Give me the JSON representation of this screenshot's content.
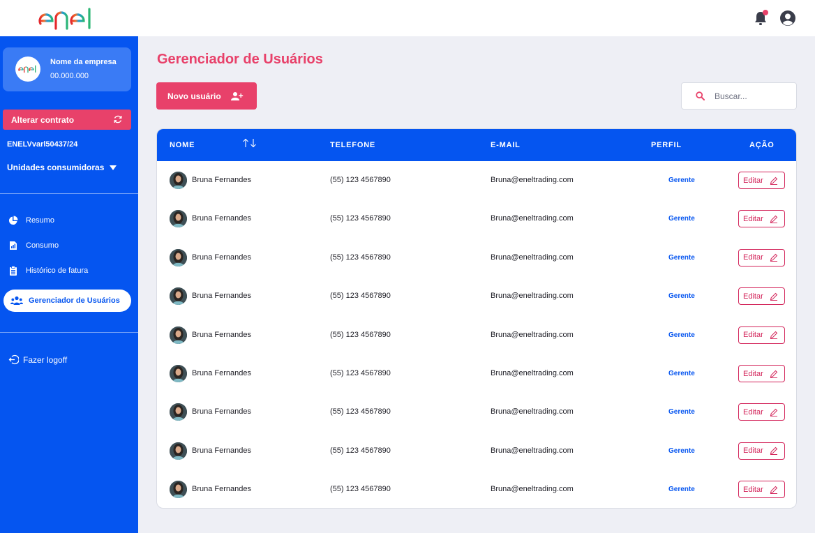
{
  "header": {
    "logo_text": "enel",
    "notification_icon": "bell-icon",
    "account_icon": "user-circle-icon"
  },
  "sidebar": {
    "company": {
      "name": "Nome da empresa",
      "code": "00.000.000",
      "avatar_text": "enel"
    },
    "change_contract_label": "Alterar contrato",
    "contract_code": "ENELVvarl50437/24",
    "units_label": "Unidades consumidoras",
    "nav": [
      {
        "label": "Resumo",
        "icon": "pie-chart-icon"
      },
      {
        "label": "Consumo",
        "icon": "bar-document-icon"
      },
      {
        "label": "Histórico de fatura",
        "icon": "clipboard-list-icon"
      },
      {
        "label": "Gerenciador de Usuários",
        "icon": "users-icon",
        "active": true
      }
    ],
    "logoff_label": "Fazer logoff"
  },
  "main": {
    "title": "Gerenciador de Usuários",
    "new_user_label": "Novo usuário",
    "search_placeholder": "Buscar...",
    "table": {
      "columns": [
        "NOME",
        "TELEFONE",
        "E-MAIL",
        "PERFIL",
        "AÇÃO"
      ],
      "sort_glyph": "↑↓",
      "rows": [
        {
          "name": "Bruna Fernandes",
          "phone": "(55) 123 4567890",
          "email": "Bruna@eneltrading.com",
          "profile": "Gerente",
          "action": "Editar"
        },
        {
          "name": "Bruna Fernandes",
          "phone": "(55) 123 4567890",
          "email": "Bruna@eneltrading.com",
          "profile": "Gerente",
          "action": "Editar"
        },
        {
          "name": "Bruna Fernandes",
          "phone": "(55) 123 4567890",
          "email": "Bruna@eneltrading.com",
          "profile": "Gerente",
          "action": "Editar"
        },
        {
          "name": "Bruna Fernandes",
          "phone": "(55) 123 4567890",
          "email": "Bruna@eneltrading.com",
          "profile": "Gerente",
          "action": "Editar"
        },
        {
          "name": "Bruna Fernandes",
          "phone": "(55) 123 4567890",
          "email": "Bruna@eneltrading.com",
          "profile": "Gerente",
          "action": "Editar"
        },
        {
          "name": "Bruna Fernandes",
          "phone": "(55) 123 4567890",
          "email": "Bruna@eneltrading.com",
          "profile": "Gerente",
          "action": "Editar"
        },
        {
          "name": "Bruna Fernandes",
          "phone": "(55) 123 4567890",
          "email": "Bruna@eneltrading.com",
          "profile": "Gerente",
          "action": "Editar"
        },
        {
          "name": "Bruna Fernandes",
          "phone": "(55) 123 4567890",
          "email": "Bruna@eneltrading.com",
          "profile": "Gerente",
          "action": "Editar"
        },
        {
          "name": "Bruna Fernandes",
          "phone": "(55) 123 4567890",
          "email": "Bruna@eneltrading.com",
          "profile": "Gerente",
          "action": "Editar"
        }
      ]
    }
  },
  "colors": {
    "brand_blue": "#0555f0",
    "brand_pink": "#e8416a",
    "edit_red": "#d3245a",
    "background": "#eeeff5"
  }
}
